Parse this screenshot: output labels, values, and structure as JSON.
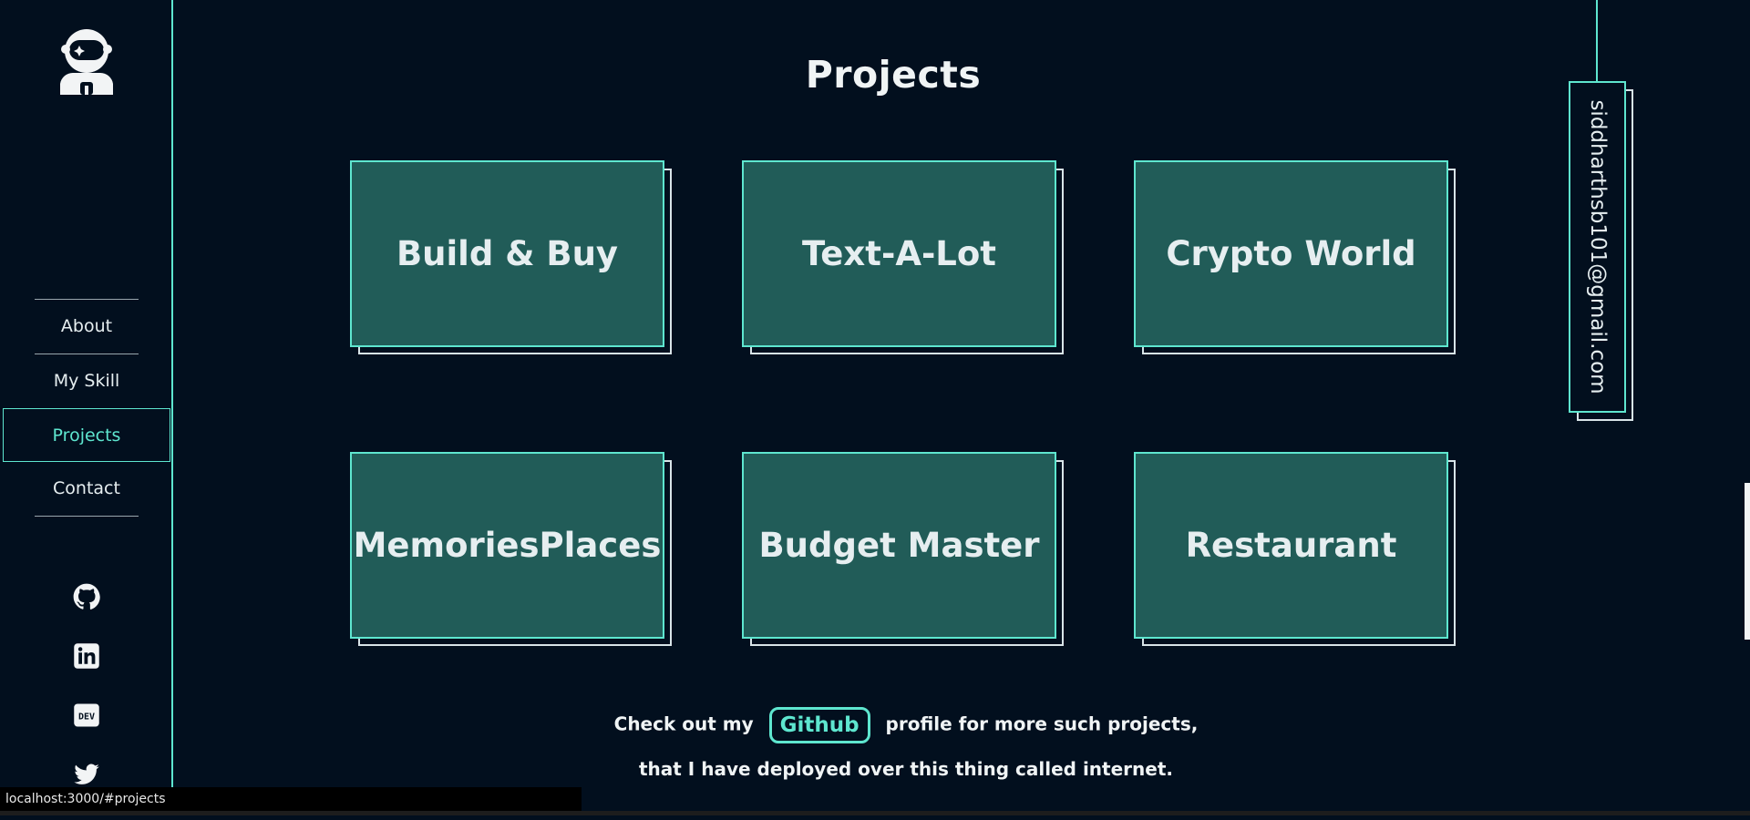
{
  "sidebar": {
    "logo": "astronaut-logo",
    "nav": [
      {
        "label": "About",
        "active": false
      },
      {
        "label": "My Skill",
        "active": false
      },
      {
        "label": "Projects",
        "active": true
      },
      {
        "label": "Contact",
        "active": false
      }
    ],
    "socials": [
      "github-icon",
      "linkedin-icon",
      "dev-icon",
      "twitter-icon"
    ],
    "dev_label": "DEV"
  },
  "main": {
    "title": "Projects",
    "projects": [
      {
        "name": "Build & Buy"
      },
      {
        "name": "Text-A-Lot"
      },
      {
        "name": "Crypto World"
      },
      {
        "name": "MemoriesPlaces"
      },
      {
        "name": "Budget Master"
      },
      {
        "name": "Restaurant"
      }
    ],
    "footer": {
      "line1_before": "Check out my",
      "github_label": "Github",
      "line1_after": "profile for more such projects,",
      "line2": "that I have deployed over this thing called internet."
    }
  },
  "email": "siddharthsb101@gmail.com",
  "status_bar": {
    "url": "localhost:3000/#projects"
  },
  "colors": {
    "background": "#020f1e",
    "accent": "#5ee6cf",
    "card": "#215c58",
    "text": "#e6eef0"
  }
}
